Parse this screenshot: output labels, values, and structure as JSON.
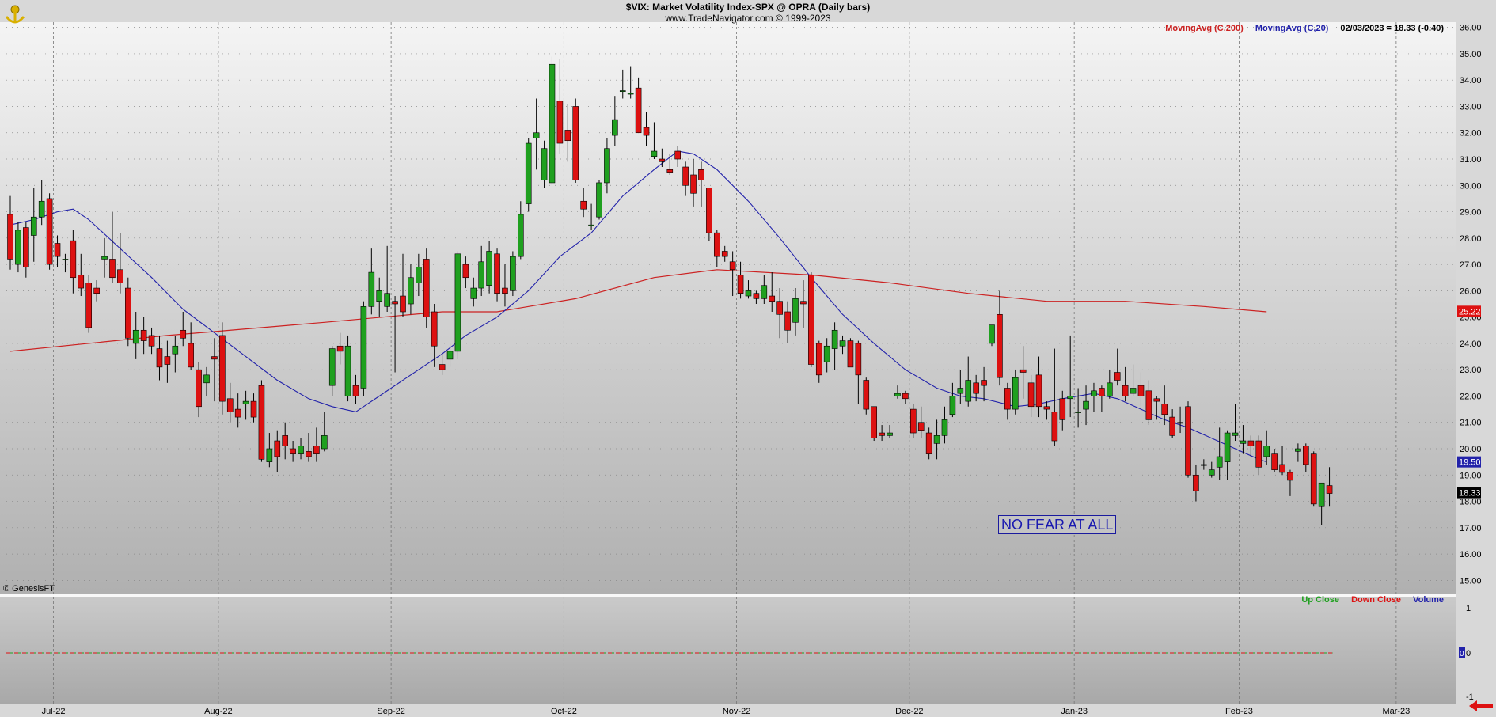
{
  "header": {
    "title": "$VIX:  Market Volatility Index-SPX @ OPRA  (Daily bars)",
    "subtitle": "www.TradeNavigator.com © 1999-2023"
  },
  "legend_top": {
    "ma200_label": "MovingAvg (C,200)",
    "ma20_label": "MovingAvg (C,20)",
    "last_readout": "02/03/2023 = 18.33 (-0.40)"
  },
  "legend_bottom": {
    "up_label": "Up Close",
    "down_label": "Down Close",
    "volume_label": "Volume"
  },
  "copyright": "© GenesisFT",
  "annotation": "NO FEAR AT ALL",
  "colors": {
    "up": "#1fa01f",
    "down": "#dd1111",
    "ma200": "#cc2222",
    "ma20": "#2222aa",
    "background": "#d8d8d8"
  },
  "chart_data": {
    "type": "candlestick",
    "ylim": [
      14.5,
      36.2
    ],
    "y_ticks": [
      "15.00",
      "16.00",
      "17.00",
      "18.00",
      "19.00",
      "20.00",
      "21.00",
      "22.00",
      "23.00",
      "24.00",
      "25.00",
      "26.00",
      "27.00",
      "28.00",
      "29.00",
      "30.00",
      "31.00",
      "32.00",
      "33.00",
      "34.00",
      "35.00",
      "36.00"
    ],
    "x_ticks": [
      {
        "label": "Jul-22",
        "index": 5.5
      },
      {
        "label": "Aug-22",
        "index": 26.5
      },
      {
        "label": "Sep-22",
        "index": 48.5
      },
      {
        "label": "Oct-22",
        "index": 70.5
      },
      {
        "label": "Nov-22",
        "index": 92.5
      },
      {
        "label": "Dec-22",
        "index": 114.5
      },
      {
        "label": "Jan-23",
        "index": 135.5
      },
      {
        "label": "Feb-23",
        "index": 156.5
      },
      {
        "label": "Mar-23",
        "index": 176.5
      }
    ],
    "candles": [
      [
        28.9,
        29.6,
        26.8,
        27.2
      ],
      [
        27.0,
        28.6,
        26.7,
        28.3
      ],
      [
        28.4,
        28.6,
        26.5,
        26.9
      ],
      [
        28.1,
        29.9,
        27.1,
        28.8
      ],
      [
        28.8,
        30.2,
        28.5,
        29.4
      ],
      [
        29.5,
        29.7,
        26.8,
        27.0
      ],
      [
        27.8,
        28.1,
        26.9,
        27.3
      ],
      [
        27.2,
        27.4,
        26.7,
        27.2
      ],
      [
        27.9,
        28.3,
        25.9,
        26.5
      ],
      [
        26.6,
        27.4,
        25.8,
        26.1
      ],
      [
        26.3,
        26.6,
        24.4,
        24.6
      ],
      [
        26.1,
        26.4,
        25.6,
        25.9
      ],
      [
        27.2,
        28.0,
        26.5,
        27.3
      ],
      [
        27.2,
        29.0,
        26.3,
        26.5
      ],
      [
        26.8,
        28.2,
        25.9,
        26.3
      ],
      [
        26.1,
        26.5,
        23.9,
        24.2
      ],
      [
        24.0,
        25.2,
        23.4,
        24.5
      ],
      [
        24.5,
        25.0,
        23.6,
        24.1
      ],
      [
        24.3,
        24.6,
        23.6,
        23.9
      ],
      [
        23.8,
        24.3,
        22.6,
        23.1
      ],
      [
        23.5,
        24.1,
        22.5,
        23.2
      ],
      [
        23.6,
        24.3,
        22.9,
        23.9
      ],
      [
        24.5,
        25.2,
        23.9,
        24.2
      ],
      [
        24.0,
        24.8,
        23.0,
        23.1
      ],
      [
        23.0,
        23.3,
        21.2,
        21.6
      ],
      [
        22.5,
        23.1,
        22.0,
        22.8
      ],
      [
        23.5,
        24.2,
        21.8,
        23.4
      ],
      [
        24.3,
        24.8,
        21.3,
        21.8
      ],
      [
        21.9,
        22.5,
        21.0,
        21.4
      ],
      [
        21.5,
        22.1,
        20.8,
        21.2
      ],
      [
        21.7,
        22.2,
        21.1,
        21.8
      ],
      [
        21.8,
        22.1,
        21.0,
        21.2
      ],
      [
        22.4,
        22.6,
        19.5,
        19.6
      ],
      [
        19.5,
        20.6,
        19.3,
        20.0
      ],
      [
        20.3,
        20.7,
        19.1,
        19.7
      ],
      [
        20.5,
        21.0,
        19.6,
        20.1
      ],
      [
        20.0,
        20.3,
        19.5,
        19.8
      ],
      [
        19.8,
        20.4,
        19.6,
        20.1
      ],
      [
        19.9,
        20.6,
        19.5,
        19.7
      ],
      [
        20.1,
        20.8,
        19.5,
        19.8
      ],
      [
        20.0,
        21.4,
        19.9,
        20.5
      ],
      [
        22.4,
        23.9,
        22.0,
        23.8
      ],
      [
        23.9,
        24.4,
        23.2,
        23.7
      ],
      [
        22.0,
        24.3,
        21.8,
        23.9
      ],
      [
        22.4,
        22.8,
        21.7,
        22.0
      ],
      [
        22.3,
        25.6,
        22.0,
        25.4
      ],
      [
        25.4,
        27.6,
        25.1,
        26.7
      ],
      [
        25.6,
        26.5,
        25.0,
        26.0
      ],
      [
        25.4,
        27.7,
        25.2,
        25.9
      ],
      [
        25.6,
        25.8,
        22.9,
        25.5
      ],
      [
        25.8,
        27.4,
        25.0,
        25.2
      ],
      [
        25.5,
        27.0,
        25.1,
        26.5
      ],
      [
        26.3,
        27.4,
        25.8,
        26.9
      ],
      [
        27.2,
        27.6,
        24.6,
        25.0
      ],
      [
        25.2,
        25.5,
        23.1,
        23.9
      ],
      [
        23.2,
        23.6,
        22.8,
        23.0
      ],
      [
        23.4,
        24.0,
        23.1,
        23.7
      ],
      [
        23.7,
        27.5,
        23.4,
        27.4
      ],
      [
        27.0,
        27.3,
        26.1,
        26.5
      ],
      [
        25.7,
        26.5,
        25.4,
        26.1
      ],
      [
        26.1,
        27.7,
        25.8,
        27.1
      ],
      [
        26.2,
        27.9,
        25.9,
        27.5
      ],
      [
        27.4,
        27.6,
        25.6,
        25.9
      ],
      [
        26.1,
        27.0,
        25.4,
        25.9
      ],
      [
        26.0,
        27.5,
        25.8,
        27.3
      ],
      [
        27.3,
        29.4,
        27.2,
        28.9
      ],
      [
        29.3,
        31.8,
        29.0,
        31.6
      ],
      [
        31.8,
        33.3,
        30.6,
        32.0
      ],
      [
        30.2,
        31.7,
        29.9,
        31.4
      ],
      [
        30.1,
        34.9,
        30.0,
        34.6
      ],
      [
        33.2,
        34.8,
        31.2,
        31.6
      ],
      [
        32.1,
        33.1,
        30.9,
        31.7
      ],
      [
        33.0,
        33.3,
        30.1,
        30.2
      ],
      [
        29.4,
        29.9,
        28.8,
        29.1
      ],
      [
        28.5,
        29.3,
        28.3,
        28.5
      ],
      [
        28.8,
        30.2,
        28.7,
        30.1
      ],
      [
        30.1,
        31.8,
        29.7,
        31.4
      ],
      [
        31.9,
        33.4,
        31.5,
        32.5
      ],
      [
        33.6,
        34.4,
        33.3,
        33.6
      ],
      [
        33.5,
        34.5,
        33.3,
        33.5
      ],
      [
        33.7,
        34.1,
        32.0,
        32.0
      ],
      [
        32.2,
        32.8,
        31.5,
        31.9
      ],
      [
        31.1,
        32.4,
        31.0,
        31.3
      ],
      [
        31.0,
        31.4,
        30.7,
        30.9
      ],
      [
        30.6,
        31.2,
        30.4,
        30.5
      ],
      [
        31.3,
        31.5,
        30.7,
        31.0
      ],
      [
        30.7,
        30.9,
        29.6,
        30.0
      ],
      [
        30.4,
        31.0,
        29.2,
        29.7
      ],
      [
        30.6,
        30.9,
        29.2,
        30.2
      ],
      [
        29.9,
        29.9,
        27.9,
        28.2
      ],
      [
        28.2,
        28.3,
        26.9,
        27.3
      ],
      [
        27.5,
        27.7,
        27.1,
        27.3
      ],
      [
        27.1,
        27.5,
        25.8,
        26.8
      ],
      [
        26.6,
        27.1,
        25.7,
        25.9
      ],
      [
        25.8,
        26.4,
        25.7,
        26.0
      ],
      [
        25.9,
        26.0,
        25.5,
        25.7
      ],
      [
        25.7,
        26.6,
        25.5,
        26.2
      ],
      [
        25.8,
        26.7,
        25.2,
        25.6
      ],
      [
        25.6,
        26.1,
        24.2,
        25.1
      ],
      [
        25.2,
        25.6,
        24.0,
        24.5
      ],
      [
        24.8,
        26.1,
        24.3,
        25.7
      ],
      [
        25.6,
        26.4,
        24.6,
        25.5
      ],
      [
        26.6,
        26.7,
        23.1,
        23.2
      ],
      [
        24.0,
        24.1,
        22.5,
        22.8
      ],
      [
        23.3,
        24.2,
        22.9,
        23.9
      ],
      [
        23.8,
        24.8,
        23.0,
        24.5
      ],
      [
        23.9,
        24.3,
        23.6,
        24.1
      ],
      [
        24.1,
        24.2,
        23.2,
        23.1
      ],
      [
        24.0,
        24.1,
        21.7,
        22.8
      ],
      [
        22.6,
        22.7,
        21.3,
        21.5
      ],
      [
        21.6,
        21.6,
        20.3,
        20.4
      ],
      [
        20.6,
        20.9,
        20.3,
        20.5
      ],
      [
        20.5,
        20.9,
        20.4,
        20.6
      ],
      [
        22.0,
        22.4,
        21.9,
        22.1
      ],
      [
        22.1,
        22.2,
        21.7,
        21.9
      ],
      [
        21.5,
        21.7,
        20.4,
        20.6
      ],
      [
        21.0,
        21.6,
        20.4,
        20.7
      ],
      [
        20.6,
        20.8,
        19.6,
        19.8
      ],
      [
        20.2,
        21.1,
        19.6,
        20.5
      ],
      [
        20.5,
        21.6,
        20.2,
        21.1
      ],
      [
        21.3,
        22.5,
        21.2,
        22.0
      ],
      [
        22.1,
        23.0,
        21.7,
        22.3
      ],
      [
        21.8,
        23.5,
        21.6,
        22.6
      ],
      [
        22.5,
        22.8,
        21.8,
        22.1
      ],
      [
        22.6,
        23.1,
        21.8,
        22.4
      ],
      [
        24.0,
        24.6,
        23.9,
        24.7
      ],
      [
        25.1,
        26.0,
        22.4,
        22.7
      ],
      [
        22.3,
        22.5,
        21.1,
        21.5
      ],
      [
        21.5,
        23.0,
        21.3,
        22.7
      ],
      [
        23.0,
        23.9,
        21.9,
        22.9
      ],
      [
        22.5,
        22.8,
        21.2,
        21.6
      ],
      [
        22.8,
        23.5,
        21.2,
        21.6
      ],
      [
        21.6,
        21.8,
        21.1,
        21.5
      ],
      [
        21.4,
        23.8,
        20.1,
        20.3
      ],
      [
        21.9,
        22.2,
        20.7,
        21.1
      ],
      [
        21.9,
        24.3,
        21.2,
        22.0
      ],
      [
        21.4,
        22.3,
        20.8,
        21.4
      ],
      [
        21.5,
        22.4,
        20.9,
        21.8
      ],
      [
        22.0,
        22.5,
        21.4,
        22.2
      ],
      [
        22.3,
        22.4,
        21.4,
        22.0
      ],
      [
        22.0,
        23.0,
        21.9,
        22.5
      ],
      [
        22.9,
        23.8,
        22.4,
        22.6
      ],
      [
        22.4,
        23.1,
        21.8,
        22.0
      ],
      [
        22.1,
        23.2,
        22.0,
        22.3
      ],
      [
        22.4,
        22.9,
        21.6,
        22.0
      ],
      [
        22.2,
        22.6,
        20.9,
        21.1
      ],
      [
        21.9,
        22.0,
        21.1,
        21.8
      ],
      [
        21.7,
        22.4,
        20.9,
        21.3
      ],
      [
        21.2,
        21.5,
        20.4,
        20.5
      ],
      [
        21.0,
        21.6,
        20.6,
        21.0
      ],
      [
        21.6,
        21.8,
        18.9,
        19.0
      ],
      [
        19.0,
        19.4,
        18.0,
        18.4
      ],
      [
        19.4,
        19.6,
        19.2,
        19.4
      ],
      [
        19.0,
        19.5,
        18.9,
        19.2
      ],
      [
        19.3,
        20.8,
        18.8,
        19.7
      ],
      [
        19.5,
        20.7,
        18.8,
        20.6
      ],
      [
        20.5,
        21.7,
        20.3,
        20.6
      ],
      [
        20.2,
        20.9,
        19.8,
        20.3
      ],
      [
        20.3,
        20.5,
        19.7,
        20.1
      ],
      [
        20.3,
        20.5,
        19.0,
        19.3
      ],
      [
        19.7,
        20.7,
        19.4,
        20.1
      ],
      [
        19.8,
        20.0,
        19.1,
        19.2
      ],
      [
        19.4,
        20.1,
        19.0,
        19.1
      ],
      [
        19.1,
        19.2,
        18.2,
        18.8
      ],
      [
        19.9,
        20.2,
        19.5,
        20.0
      ],
      [
        20.1,
        20.2,
        19.1,
        19.4
      ],
      [
        19.8,
        19.9,
        17.8,
        17.9
      ],
      [
        17.8,
        18.7,
        17.1,
        18.7
      ],
      [
        18.6,
        19.3,
        17.8,
        18.3
      ]
    ],
    "ma200": [
      [
        0,
        23.7
      ],
      [
        20,
        24.3
      ],
      [
        40,
        24.8
      ],
      [
        55,
        25.2
      ],
      [
        62,
        25.2
      ],
      [
        72,
        25.7
      ],
      [
        82,
        26.5
      ],
      [
        90,
        26.8
      ],
      [
        102,
        26.6
      ],
      [
        112,
        26.3
      ],
      [
        122,
        25.9
      ],
      [
        132,
        25.6
      ],
      [
        142,
        25.6
      ],
      [
        152,
        25.4
      ],
      [
        160,
        25.2
      ]
    ],
    "ma20": [
      [
        0,
        28.5
      ],
      [
        3,
        28.7
      ],
      [
        6,
        29.0
      ],
      [
        8,
        29.1
      ],
      [
        10,
        28.7
      ],
      [
        14,
        27.6
      ],
      [
        18,
        26.5
      ],
      [
        22,
        25.3
      ],
      [
        26,
        24.4
      ],
      [
        30,
        23.5
      ],
      [
        34,
        22.6
      ],
      [
        38,
        21.9
      ],
      [
        41,
        21.6
      ],
      [
        44,
        21.4
      ],
      [
        47,
        22.0
      ],
      [
        51,
        22.8
      ],
      [
        55,
        23.6
      ],
      [
        58,
        24.3
      ],
      [
        62,
        25.0
      ],
      [
        66,
        26.0
      ],
      [
        70,
        27.3
      ],
      [
        74,
        28.2
      ],
      [
        78,
        29.6
      ],
      [
        82,
        30.6
      ],
      [
        85,
        31.3
      ],
      [
        87,
        31.2
      ],
      [
        90,
        30.6
      ],
      [
        94,
        29.4
      ],
      [
        98,
        28.0
      ],
      [
        102,
        26.5
      ],
      [
        106,
        25.1
      ],
      [
        110,
        24.0
      ],
      [
        114,
        23.0
      ],
      [
        118,
        22.3
      ],
      [
        121,
        22.0
      ],
      [
        124,
        21.9
      ],
      [
        128,
        21.6
      ],
      [
        131,
        21.7
      ],
      [
        134,
        21.9
      ],
      [
        138,
        22.1
      ],
      [
        141,
        21.9
      ],
      [
        144,
        21.5
      ],
      [
        147,
        21.1
      ],
      [
        150,
        20.8
      ],
      [
        153,
        20.4
      ],
      [
        156,
        20.0
      ],
      [
        159,
        19.6
      ],
      [
        160,
        19.5
      ]
    ],
    "price_tags": [
      {
        "value": 25.22,
        "label": "25.22",
        "color": "#dd1111"
      },
      {
        "value": 19.5,
        "label": "19.50",
        "color": "#2222aa"
      },
      {
        "value": 18.33,
        "label": "18.33",
        "color": "#000000"
      }
    ],
    "volume_panel": {
      "y_ticks": [
        "1",
        "0",
        "-1"
      ],
      "zero_line_label": "0"
    }
  }
}
